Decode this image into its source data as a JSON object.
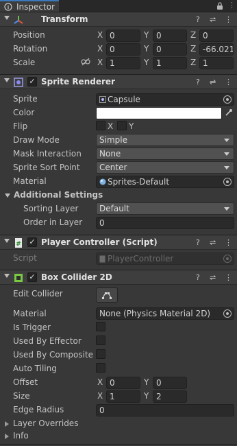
{
  "tab": {
    "label": "Inspector"
  },
  "transform": {
    "title": "Transform",
    "position": {
      "label": "Position",
      "x": "0",
      "y": "0",
      "z": "0"
    },
    "rotation": {
      "label": "Rotation",
      "x": "0",
      "y": "0",
      "z": "-66.021"
    },
    "scale": {
      "label": "Scale",
      "x": "1",
      "y": "1",
      "z": "1"
    }
  },
  "axis": {
    "x": "X",
    "y": "Y",
    "z": "Z"
  },
  "sprite_renderer": {
    "title": "Sprite Renderer",
    "sprite_label": "Sprite",
    "sprite_value": "Capsule",
    "color_label": "Color",
    "color_value": "#ffffff",
    "flip_label": "Flip",
    "flip_x": "X",
    "flip_y": "Y",
    "draw_mode_label": "Draw Mode",
    "draw_mode_value": "Simple",
    "mask_label": "Mask Interaction",
    "mask_value": "None",
    "sort_point_label": "Sprite Sort Point",
    "sort_point_value": "Center",
    "material_label": "Material",
    "material_value": "Sprites-Default",
    "additional_label": "Additional Settings",
    "sorting_layer_label": "Sorting Layer",
    "sorting_layer_value": "Default",
    "order_label": "Order in Layer",
    "order_value": "0"
  },
  "player_controller": {
    "title": "Player Controller (Script)",
    "script_label": "Script",
    "script_value": "PlayerController"
  },
  "box_collider": {
    "title": "Box Collider 2D",
    "edit_label": "Edit Collider",
    "material_label": "Material",
    "material_value": "None (Physics Material 2D)",
    "is_trigger_label": "Is Trigger",
    "used_by_effector_label": "Used By Effector",
    "used_by_composite_label": "Used By Composite",
    "auto_tiling_label": "Auto Tiling",
    "offset_label": "Offset",
    "offset_x": "0",
    "offset_y": "0",
    "size_label": "Size",
    "size_x": "1",
    "size_y": "2",
    "edge_radius_label": "Edge Radius",
    "edge_radius_value": "0",
    "layer_overrides_label": "Layer Overrides",
    "info_label": "Info"
  },
  "colors": {
    "accent": "#3a79bb",
    "panel": "#383838",
    "header": "#3e3e3e"
  }
}
